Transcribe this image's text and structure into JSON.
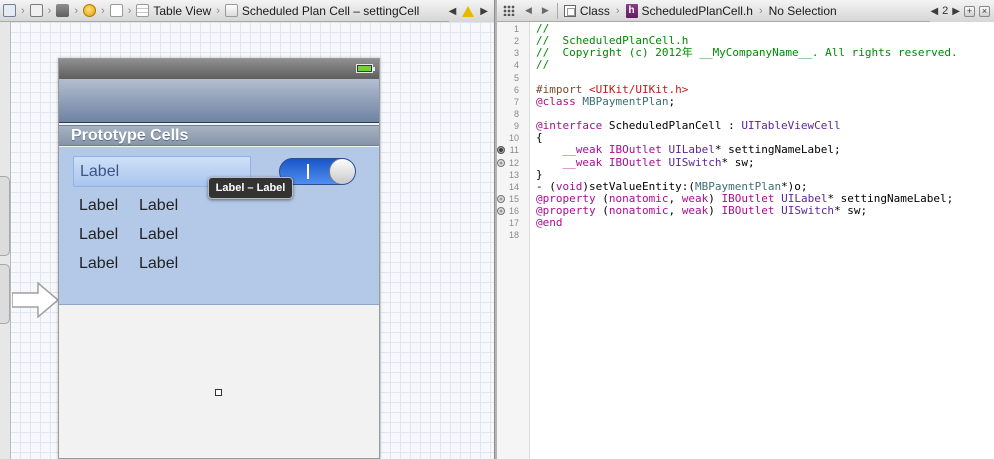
{
  "ib_jump_bar": {
    "segments": [
      "Table View",
      "Scheduled Plan Cell – settingCell"
    ]
  },
  "ib_canvas": {
    "section_header": "Prototype Cells",
    "selected_label": "Label",
    "labels": [
      [
        "Label",
        "Label"
      ],
      [
        "Label",
        "Label"
      ],
      [
        "Label",
        "Label"
      ]
    ],
    "tooltip": "Label – Label",
    "switch_on": true
  },
  "editor_jump_bar": {
    "mode": "Class",
    "file": "ScheduledPlanCell.h",
    "selection": "No Selection",
    "counterpart_count": "2"
  },
  "code_lines": [
    {
      "n": "1",
      "marker": "",
      "tokens": [
        [
          "c-comment",
          "//"
        ]
      ]
    },
    {
      "n": "2",
      "marker": "",
      "tokens": [
        [
          "c-comment",
          "//  ScheduledPlanCell.h"
        ]
      ]
    },
    {
      "n": "3",
      "marker": "",
      "tokens": [
        [
          "c-comment",
          "//  Copyright (c) 2012年 __MyCompanyName__. All rights reserved."
        ]
      ]
    },
    {
      "n": "4",
      "marker": "",
      "tokens": [
        [
          "c-comment",
          "//"
        ]
      ]
    },
    {
      "n": "5",
      "marker": "",
      "tokens": []
    },
    {
      "n": "6",
      "marker": "",
      "tokens": [
        [
          "c-directive",
          "#import "
        ],
        [
          "c-string",
          "<UIKit/UIKit.h>"
        ]
      ]
    },
    {
      "n": "7",
      "marker": "",
      "tokens": [
        [
          "c-keyword",
          "@class"
        ],
        [
          "",
          " "
        ],
        [
          "c-class",
          "MBPaymentPlan"
        ],
        [
          "",
          ";"
        ]
      ]
    },
    {
      "n": "8",
      "marker": "",
      "tokens": []
    },
    {
      "n": "9",
      "marker": "",
      "tokens": [
        [
          "c-keyword",
          "@interface"
        ],
        [
          "",
          " ScheduledPlanCell : "
        ],
        [
          "c-type",
          "UITableViewCell"
        ]
      ]
    },
    {
      "n": "10",
      "marker": "",
      "tokens": [
        [
          "",
          "{"
        ]
      ]
    },
    {
      "n": "11",
      "marker": "filled",
      "tokens": [
        [
          "",
          "    "
        ],
        [
          "c-keyword",
          "__weak"
        ],
        [
          "",
          " "
        ],
        [
          "c-keyword",
          "IBOutlet"
        ],
        [
          "",
          " "
        ],
        [
          "c-type",
          "UILabel"
        ],
        [
          "",
          "* settingNameLabel;"
        ]
      ]
    },
    {
      "n": "12",
      "marker": "empty",
      "tokens": [
        [
          "",
          "    "
        ],
        [
          "c-keyword",
          "__weak"
        ],
        [
          "",
          " "
        ],
        [
          "c-keyword",
          "IBOutlet"
        ],
        [
          "",
          " "
        ],
        [
          "c-type",
          "UISwitch"
        ],
        [
          "",
          "* sw;"
        ]
      ]
    },
    {
      "n": "13",
      "marker": "",
      "tokens": [
        [
          "",
          "}"
        ]
      ]
    },
    {
      "n": "14",
      "marker": "",
      "tokens": [
        [
          "",
          "- ("
        ],
        [
          "c-keyword",
          "void"
        ],
        [
          "",
          ")setValueEntity:("
        ],
        [
          "c-class",
          "MBPaymentPlan"
        ],
        [
          "",
          "*)o;"
        ]
      ]
    },
    {
      "n": "15",
      "marker": "empty",
      "tokens": [
        [
          "c-keyword",
          "@property"
        ],
        [
          "",
          " ("
        ],
        [
          "c-keyword",
          "nonatomic"
        ],
        [
          "",
          ", "
        ],
        [
          "c-keyword",
          "weak"
        ],
        [
          "",
          ") "
        ],
        [
          "c-keyword",
          "IBOutlet"
        ],
        [
          "",
          " "
        ],
        [
          "c-type",
          "UILabel"
        ],
        [
          "",
          "* settingNameLabel;"
        ]
      ]
    },
    {
      "n": "16",
      "marker": "empty",
      "tokens": [
        [
          "c-keyword",
          "@property"
        ],
        [
          "",
          " ("
        ],
        [
          "c-keyword",
          "nonatomic"
        ],
        [
          "",
          ", "
        ],
        [
          "c-keyword",
          "weak"
        ],
        [
          "",
          ") "
        ],
        [
          "c-keyword",
          "IBOutlet"
        ],
        [
          "",
          " "
        ],
        [
          "c-type",
          "UISwitch"
        ],
        [
          "",
          "* sw;"
        ]
      ]
    },
    {
      "n": "17",
      "marker": "",
      "tokens": [
        [
          "c-keyword",
          "@end"
        ]
      ]
    },
    {
      "n": "18",
      "marker": "",
      "tokens": []
    }
  ]
}
